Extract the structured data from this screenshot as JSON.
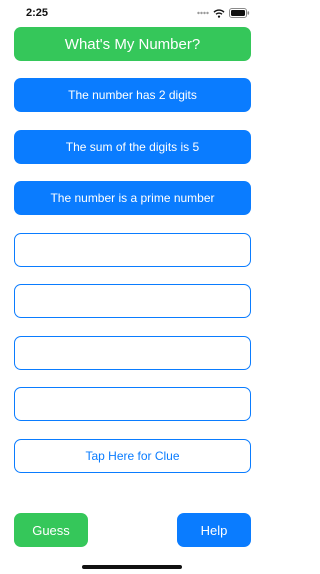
{
  "status_bar": {
    "time": "2:25",
    "icons": [
      "cellular-dots-icon",
      "wifi-icon",
      "battery-icon"
    ]
  },
  "title": "What's My Number?",
  "clues": [
    "The number has 2 digits",
    "The sum of the digits is 5",
    "The number is a prime number",
    "",
    "",
    "",
    ""
  ],
  "tap_clue_label": "Tap Here for Clue",
  "buttons": {
    "guess_label": "Guess",
    "help_label": "Help"
  },
  "colors": {
    "accent_blue": "#0a7cff",
    "accent_green": "#35c75a"
  }
}
